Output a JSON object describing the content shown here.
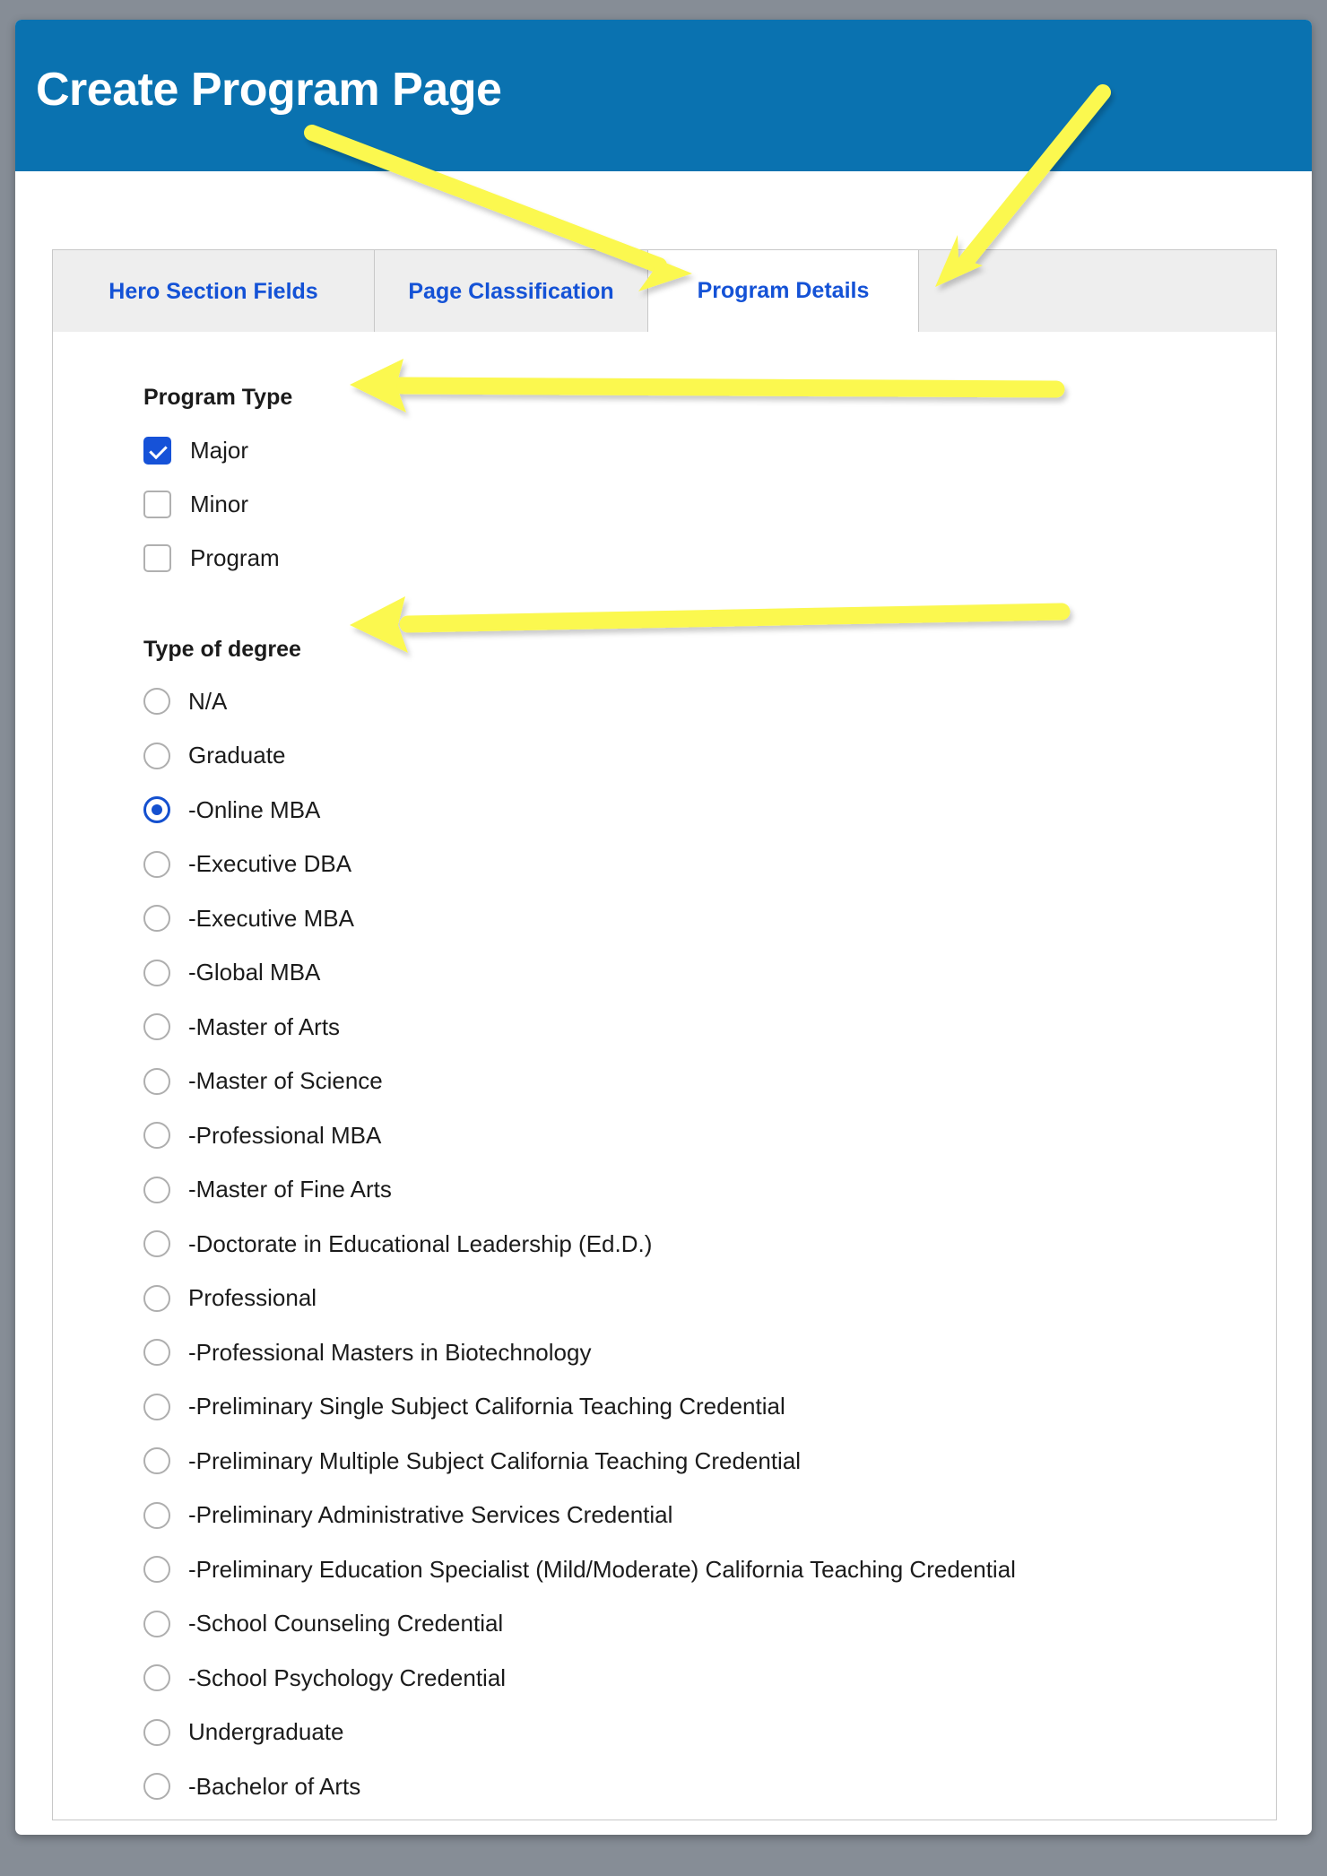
{
  "window": {
    "background_color": "#868d96",
    "card_background": "#ffffff"
  },
  "header": {
    "title": "Create Program Page",
    "background_color": "#0a72b0",
    "text_color": "#ffffff"
  },
  "tabs": {
    "active_index": 2,
    "link_color": "#1452d6",
    "items": [
      {
        "label": "Hero Section Fields",
        "active": false
      },
      {
        "label": "Page Classification",
        "active": false
      },
      {
        "label": "Program Details",
        "active": true
      },
      {
        "label": "",
        "active": false
      }
    ]
  },
  "main": {
    "program_type": {
      "label": "Program Type",
      "control": "checkbox",
      "accent_color": "#1652d8",
      "options": [
        {
          "label": "Major",
          "checked": true
        },
        {
          "label": "Minor",
          "checked": false
        },
        {
          "label": "Program",
          "checked": false
        }
      ]
    },
    "type_of_degree": {
      "label": "Type of degree",
      "control": "radio",
      "accent_color": "#1450cf",
      "selected": "-Online MBA",
      "options": [
        {
          "label": "N/A",
          "selected": false
        },
        {
          "label": "Graduate",
          "selected": false
        },
        {
          "label": "-Online MBA",
          "selected": true
        },
        {
          "label": "-Executive DBA",
          "selected": false
        },
        {
          "label": "-Executive MBA",
          "selected": false
        },
        {
          "label": "-Global MBA",
          "selected": false
        },
        {
          "label": "-Master of Arts",
          "selected": false
        },
        {
          "label": "-Master of Science",
          "selected": false
        },
        {
          "label": "-Professional MBA",
          "selected": false
        },
        {
          "label": "-Master of Fine Arts",
          "selected": false
        },
        {
          "label": "-Doctorate in Educational Leadership (Ed.D.)",
          "selected": false
        },
        {
          "label": "Professional",
          "selected": false
        },
        {
          "label": "-Professional Masters in Biotechnology",
          "selected": false
        },
        {
          "label": "-Preliminary Single Subject California Teaching Credential",
          "selected": false
        },
        {
          "label": "-Preliminary Multiple Subject California Teaching Credential",
          "selected": false
        },
        {
          "label": "-Preliminary Administrative Services Credential",
          "selected": false
        },
        {
          "label": "-Preliminary Education Specialist (Mild/Moderate) California Teaching Credential",
          "selected": false
        },
        {
          "label": "-School Counseling Credential",
          "selected": false
        },
        {
          "label": "-School Psychology Credential",
          "selected": false
        },
        {
          "label": "Undergraduate",
          "selected": false
        },
        {
          "label": "-Bachelor of Arts",
          "selected": false
        }
      ]
    }
  },
  "annotations": {
    "color": "#fbf84f",
    "arrows": [
      {
        "name": "arrow-to-program-details-tab-from-title",
        "points_to": "Program Details"
      },
      {
        "name": "arrow-to-program-details-tab-from-right",
        "points_to": "Program Details"
      },
      {
        "name": "arrow-to-program-type",
        "points_to": "Program Type"
      },
      {
        "name": "arrow-to-type-of-degree",
        "points_to": "Type of degree"
      }
    ]
  }
}
